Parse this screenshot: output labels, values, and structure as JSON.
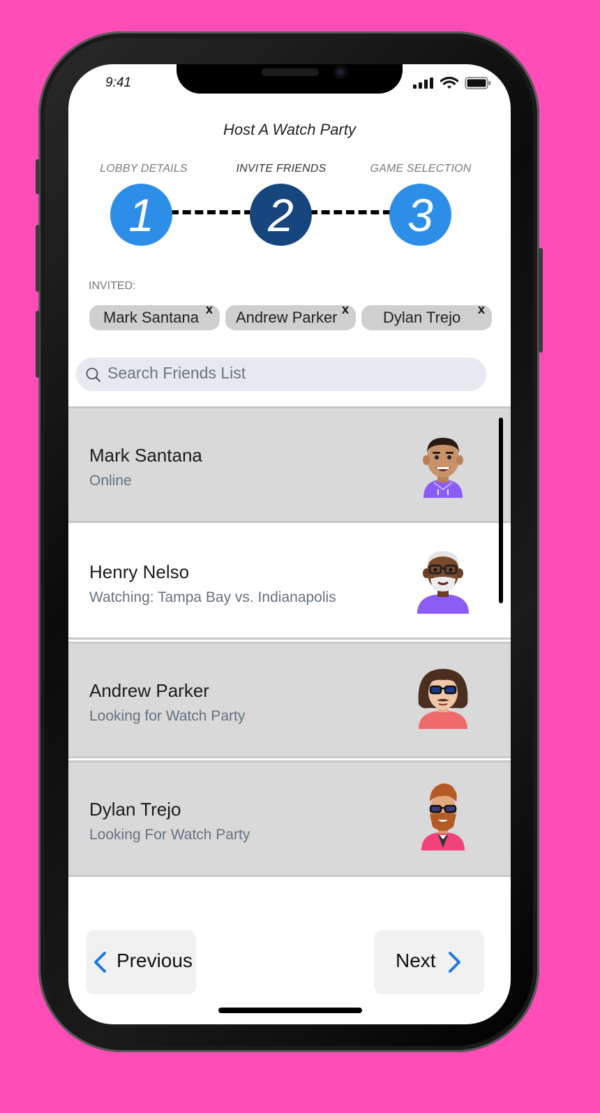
{
  "status_bar": {
    "time": "9:41"
  },
  "header": {
    "title": "Host A Watch Party"
  },
  "steps": [
    {
      "label": "LOBBY DETAILS",
      "number": "1"
    },
    {
      "label": "INVITE FRIENDS",
      "number": "2"
    },
    {
      "label": "GAME SELECTION",
      "number": "3"
    }
  ],
  "active_step": 2,
  "invited": {
    "label": "INVITED:",
    "chips": [
      {
        "name": "Mark Santana",
        "remove": "x"
      },
      {
        "name": "Andrew Parker",
        "remove": "x"
      },
      {
        "name": "Dylan Trejo",
        "remove": "x"
      }
    ]
  },
  "search": {
    "placeholder": "Search Friends List"
  },
  "friends": [
    {
      "name": "Mark Santana",
      "status": "Online",
      "avatar": "avatar-mark"
    },
    {
      "name": "Henry Nelso",
      "status": "Watching: Tampa Bay vs. Indianapolis",
      "avatar": "avatar-henry"
    },
    {
      "name": "Andrew Parker",
      "status": "Looking for Watch Party",
      "avatar": "avatar-andrew"
    },
    {
      "name": "Dylan Trejo",
      "status": "Looking For Watch Party",
      "avatar": "avatar-dylan"
    }
  ],
  "nav": {
    "previous_label": "Previous",
    "next_label": "Next"
  },
  "colors": {
    "background": "#ff4db8",
    "step_inactive": "#2d8ee8",
    "step_active": "#17467f",
    "chevron": "#1f7ae0"
  }
}
